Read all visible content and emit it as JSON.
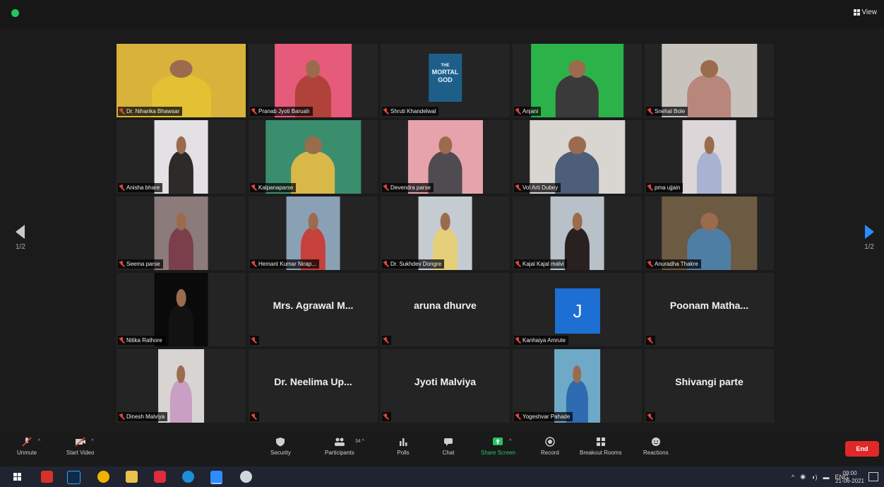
{
  "top": {
    "view_label": "View"
  },
  "nav": {
    "left_page": "1/2",
    "right_page": "1/2"
  },
  "tiles": [
    {
      "name": "Dr. Niharika Bhawsar",
      "kind": "video",
      "bg": "#d8b23a",
      "shirt": "#e2c233"
    },
    {
      "name": "Pranab Jyoti Baruah",
      "kind": "video",
      "bg": "#e65a7a",
      "shirt": "#b0423a"
    },
    {
      "name": "Shruti Khandelwal",
      "kind": "poster",
      "poster_line1": "THE",
      "poster_line2": "MORTAL",
      "poster_line3": "GOD"
    },
    {
      "name": "Anjani",
      "kind": "video",
      "bg": "#2bb34a",
      "shirt": "#3a3a3a"
    },
    {
      "name": "Snehal Bole",
      "kind": "video",
      "bg": "#c9c3bd",
      "shirt": "#b9867b"
    },
    {
      "name": "Anisha bhare",
      "kind": "video",
      "bg": "#e4e1e5",
      "shirt": "#2e2a2a"
    },
    {
      "name": "Kalpanaparse",
      "kind": "video",
      "bg": "#3a8e6d",
      "shirt": "#d9b84a"
    },
    {
      "name": "Devendra parse",
      "kind": "video",
      "bg": "#e7a3ab",
      "shirt": "#504b50"
    },
    {
      "name": "Vol Arti Dubey",
      "kind": "video",
      "bg": "#d9d5d0",
      "shirt": "#4c5e78"
    },
    {
      "name": "pma ujjain",
      "kind": "video",
      "bg": "#dcd6d8",
      "shirt": "#a7b3d0"
    },
    {
      "name": "Seema parse",
      "kind": "video",
      "bg": "#8b7b7a",
      "shirt": "#7a3f4a"
    },
    {
      "name": "Hemant Kumar Nirap...",
      "kind": "video",
      "bg": "#8aa0b5",
      "shirt": "#c6403c"
    },
    {
      "name": "Dr. Sukhdev Dongre",
      "kind": "video",
      "bg": "#c5ccd1",
      "shirt": "#e6cf7a"
    },
    {
      "name": "Kajal Kajal malvi",
      "kind": "video",
      "bg": "#b8c0c8",
      "shirt": "#2a2020"
    },
    {
      "name": "Anuradha Thakre",
      "kind": "video",
      "bg": "#6c5a43",
      "shirt": "#4f7ea5"
    },
    {
      "name": "Nitika Rathore",
      "kind": "video",
      "bg": "#0a0a0a",
      "shirt": "#121212"
    },
    {
      "name": "",
      "kind": "name",
      "display": "Mrs. Agrawal M..."
    },
    {
      "name": "",
      "kind": "name",
      "display": "aruna dhurve"
    },
    {
      "name": "Kanhaiya Amrute",
      "kind": "avatar",
      "initial": "J"
    },
    {
      "name": "",
      "kind": "name",
      "display": "Poonam Matha..."
    },
    {
      "name": "Dinesh Malviya",
      "kind": "video",
      "bg": "#d8d4d2",
      "shirt": "#c99fc3"
    },
    {
      "name": "",
      "kind": "name",
      "display": "Dr. Neelima Up..."
    },
    {
      "name": "",
      "kind": "name",
      "display": "Jyoti Malviya"
    },
    {
      "name": "Yogeshvar Pahade",
      "kind": "video",
      "bg": "#6fa9c8",
      "shirt": "#2f6bb0"
    },
    {
      "name": "",
      "kind": "name",
      "display": "Shivangi parte"
    }
  ],
  "toolbar": {
    "unmute": "Unmute",
    "start_video": "Start Video",
    "security": "Security",
    "participants": "Participants",
    "participants_count": "34",
    "polls": "Polls",
    "chat": "Chat",
    "share_screen": "Share Screen",
    "record": "Record",
    "breakout_rooms": "Breakout Rooms",
    "reactions": "Reactions",
    "end": "End"
  },
  "taskbar": {
    "lang": "ENG",
    "time": "09:00",
    "date": "21-06-2021"
  },
  "colors": {
    "accent": "#2d8cff",
    "share": "#23c55e",
    "end": "#e02828",
    "active_border": "#e6e84d"
  }
}
